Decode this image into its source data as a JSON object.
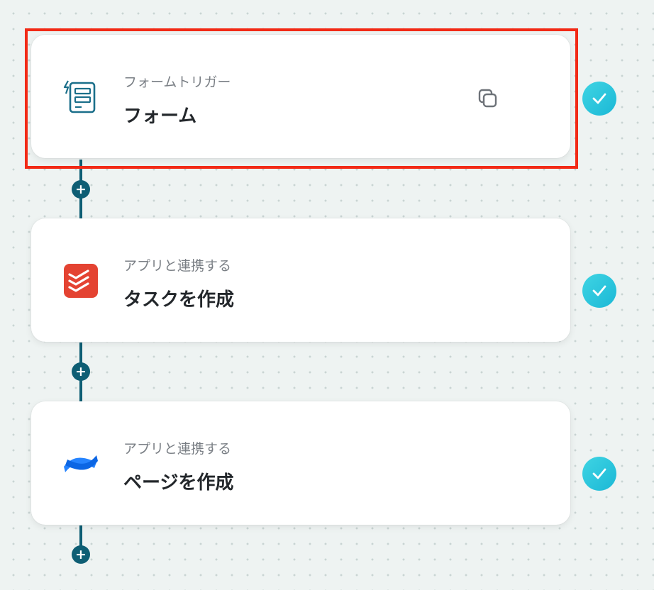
{
  "steps": [
    {
      "subtitle": "フォームトリガー",
      "title": "フォーム",
      "icon": "form-trigger-icon",
      "status": "completed"
    },
    {
      "subtitle": "アプリと連携する",
      "title": "タスクを作成",
      "icon": "todoist-icon",
      "status": "completed"
    },
    {
      "subtitle": "アプリと連携する",
      "title": "ページを作成",
      "icon": "confluence-icon",
      "status": "completed"
    }
  ],
  "add_button_label": "+",
  "colors": {
    "connector": "#0e5e74",
    "highlight": "#f22a16",
    "check": "#27c3da",
    "todoist": "#e44332",
    "confluence": "#1868db"
  }
}
